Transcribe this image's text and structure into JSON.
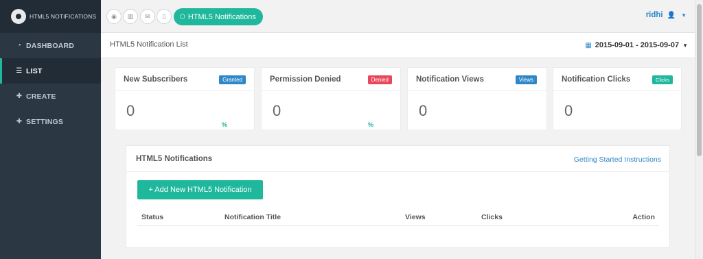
{
  "brand": {
    "name": "HTML5 NOTIFICATIONS",
    "logo_icon": "logo-icon"
  },
  "sidebar": {
    "items": [
      {
        "label": "DASHBOARD",
        "icon": "dashboard-icon",
        "active": false
      },
      {
        "label": "LIST",
        "icon": "list-icon",
        "active": true
      },
      {
        "label": "CREATE",
        "icon": "plus-icon",
        "active": false
      },
      {
        "label": "SETTINGS",
        "icon": "plus-icon",
        "active": false
      }
    ]
  },
  "topbar": {
    "icons": [
      "globe-icon",
      "bar-chart-icon",
      "envelope-icon",
      "mobile-icon"
    ],
    "active_pill": {
      "label": "HTML5 Notifications",
      "icon": "html5-icon"
    },
    "user": {
      "name": "ridhi",
      "icon": "user-icon"
    }
  },
  "page": {
    "title": "HTML5 Notification List",
    "date_range": "2015-09-01 - 2015-09-07"
  },
  "cards": [
    {
      "title": "New Subscribers",
      "badge": "Granted",
      "badge_color": "#2e87c8",
      "value": "0",
      "pct": "%"
    },
    {
      "title": "Permission Denied",
      "badge": "Denied",
      "badge_color": "#e8475b",
      "value": "0",
      "pct": "%"
    },
    {
      "title": "Notification Views",
      "badge": "Views",
      "badge_color": "#2e87c8",
      "value": "0",
      "pct": ""
    },
    {
      "title": "Notification Clicks",
      "badge": "Clicks",
      "badge_color": "#1fb89d",
      "value": "0",
      "pct": ""
    }
  ],
  "panel": {
    "title": "HTML5 Notifications",
    "link": "Getting Started Instructions",
    "add_button": "+ Add New HTML5 Notification",
    "columns": [
      "Status",
      "Notification Title",
      "Views",
      "Clicks",
      "Action"
    ]
  },
  "colors": {
    "accent": "#1fb89d",
    "link": "#2e87c8",
    "sidebar": "#2b3743",
    "danger": "#e8475b"
  }
}
